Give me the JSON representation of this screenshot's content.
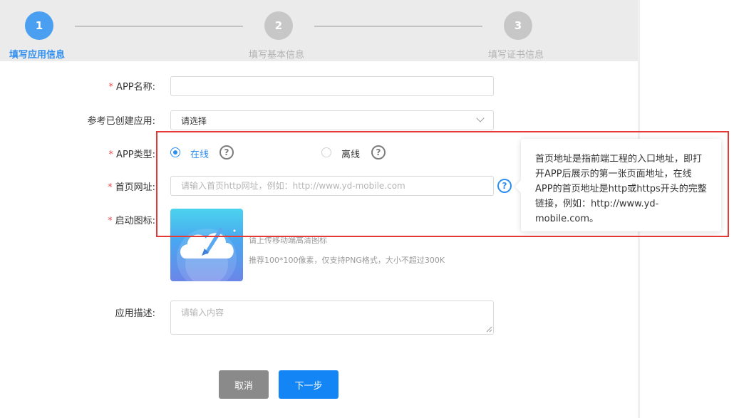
{
  "steps": [
    {
      "number": "1",
      "label": "填写应用信息"
    },
    {
      "number": "2",
      "label": "填写基本信息"
    },
    {
      "number": "3",
      "label": "填写证书信息"
    }
  ],
  "form": {
    "app_name": {
      "label": "APP名称:",
      "value": ""
    },
    "reference_app": {
      "label": "参考已创建应用:",
      "selected": "请选择"
    },
    "app_type": {
      "label": "APP类型:",
      "options": [
        "在线",
        "离线"
      ],
      "selected": "在线"
    },
    "homepage_url": {
      "label": "首页网址:",
      "placeholder": "请输入首页http网址，例如：http://www.yd-mobile.com"
    },
    "launch_icon": {
      "label": "启动图标:",
      "hint_primary": "请上传移动端高清图标",
      "hint_secondary": "推荐100*100像素，仅支持PNG格式，大小不超过300K"
    },
    "description": {
      "label": "应用描述:",
      "placeholder": "请输入内容"
    }
  },
  "tooltip": {
    "text": "首页地址是指前端工程的入口地址，即打开APP后展示的第一张页面地址，在线APP的首页地址是http或https开头的完整链接，例如：http://www.yd-mobile.com。"
  },
  "buttons": {
    "cancel": "取消",
    "next": "下一步"
  },
  "icons": {
    "help": "?"
  },
  "colors": {
    "primary": "#1485f4",
    "step_active": "#4a9ff0",
    "required": "#f24d4d",
    "highlight": "#e53935"
  }
}
